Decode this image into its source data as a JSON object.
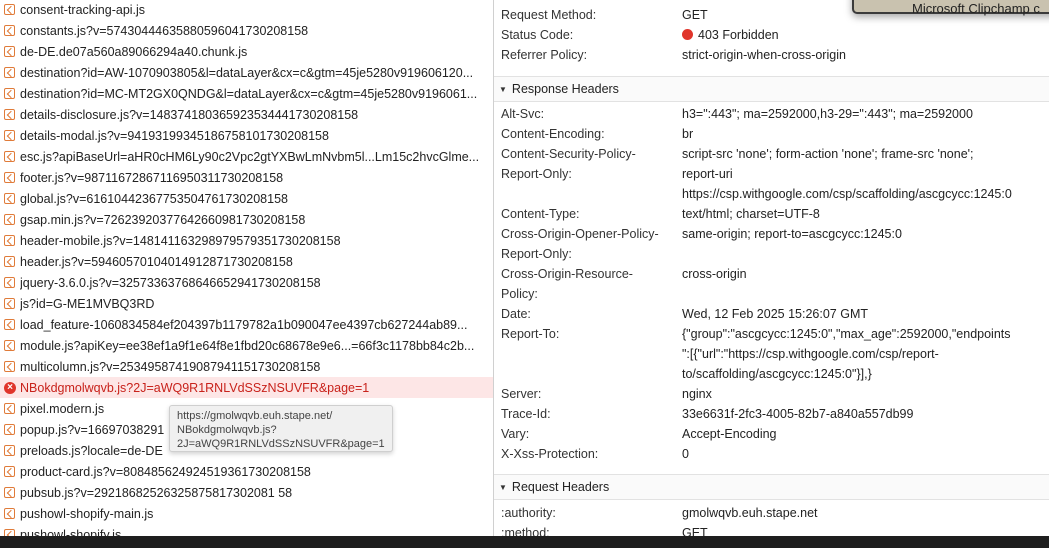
{
  "files": [
    {
      "name": "consent-tracking-api.js",
      "status": "ok"
    },
    {
      "name": "constants.js?v=57430444635880596041730208158",
      "status": "ok"
    },
    {
      "name": "de-DE.de07a560a89066294a40.chunk.js",
      "status": "ok"
    },
    {
      "name": "destination?id=AW-1070903805&l=dataLayer&cx=c&gtm=45je5280v919606120...",
      "status": "ok"
    },
    {
      "name": "destination?id=MC-MT2GX0QNDG&l=dataLayer&cx=c&gtm=45je5280v9196061...",
      "status": "ok"
    },
    {
      "name": "details-disclosure.js?v=148374180365923534441730208158",
      "status": "ok"
    },
    {
      "name": "details-modal.js?v=94193199345186758101730208158",
      "status": "ok"
    },
    {
      "name": "esc.js?apiBaseUrl=aHR0cHM6Ly90c2Vpc2gtYXBwLmNvbm5l...Lm15c2hvcGlme...",
      "status": "ok"
    },
    {
      "name": "footer.js?v=98711672867116950311730208158",
      "status": "ok"
    },
    {
      "name": "global.js?v=61610442367753504761730208158",
      "status": "ok"
    },
    {
      "name": "gsap.min.js?v=72623920377642660981730208158",
      "status": "ok"
    },
    {
      "name": "header-mobile.js?v=148141163298979579351730208158",
      "status": "ok"
    },
    {
      "name": "header.js?v=59460570104014912871730208158",
      "status": "ok"
    },
    {
      "name": "jquery-3.6.0.js?v=32573363768646652941730208158",
      "status": "ok"
    },
    {
      "name": "js?id=G-ME1MVBQ3RD",
      "status": "ok"
    },
    {
      "name": "load_feature-1060834584ef204397b1179782a1b090047ee4397cb627244ab89...",
      "status": "ok"
    },
    {
      "name": "module.js?apiKey=ee38ef1a9f1e64f8e1fbd20c68678e9e6...=66f3c1178bb84c2b...",
      "status": "ok"
    },
    {
      "name": "multicolumn.js?v=25349587419087941151730208158",
      "status": "ok"
    },
    {
      "name": "NBokdgmolwqvb.js?2J=aWQ9R1RNLVdSSzNSUVFR&page=1",
      "status": "error"
    },
    {
      "name": "pixel.modern.js",
      "status": "ok"
    },
    {
      "name": "popup.js?v=16697038291",
      "status": "ok"
    },
    {
      "name": "preloads.js?locale=de-DE",
      "status": "ok"
    },
    {
      "name": "product-card.js?v=80848562492451936173020815​8",
      "status": "ok"
    },
    {
      "name": "pubsub.js?v=29218682526325875817302081 58",
      "status": "ok"
    },
    {
      "name": "pushowl-shopify-main.js",
      "status": "ok"
    },
    {
      "name": "pushowl-shopify.js",
      "status": "ok"
    }
  ],
  "tooltip": {
    "lines": [
      "https://gmolwqvb.euh.stape.net/",
      "NBokdgmolwqvb.js?",
      "2J=aWQ9R1RNLVdSSzNSUVFR&page=1"
    ]
  },
  "general": [
    {
      "key": "Request Method:",
      "value": "GET"
    },
    {
      "key": "Status Code:",
      "value": "403 Forbidden"
    },
    {
      "key": "Referrer Policy:",
      "value": "strict-origin-when-cross-origin"
    }
  ],
  "response_section": "Response Headers",
  "response_headers": [
    {
      "key": "Alt-Svc:",
      "value": [
        "h3=\":443\"; ma=2592000,h3-29=\":443\"; ma=2592000"
      ]
    },
    {
      "key": "Content-Encoding:",
      "value": [
        "br"
      ]
    },
    {
      "key": [
        "Content-Security-Policy-",
        "Report-Only:"
      ],
      "value": [
        "script-src 'none'; form-action 'none'; frame-src 'none';",
        "report-uri",
        "https://csp.withgoogle.com/csp/scaffolding/ascgcycc:1245:0"
      ]
    },
    {
      "key": "Content-Type:",
      "value": [
        "text/html; charset=UTF-8"
      ]
    },
    {
      "key": [
        "Cross-Origin-Opener-Policy-",
        "Report-Only:"
      ],
      "value": [
        "same-origin; report-to=ascgcycc:1245:0"
      ]
    },
    {
      "key": [
        "Cross-Origin-Resource-",
        "Policy:"
      ],
      "value": [
        "cross-origin"
      ]
    },
    {
      "key": "Date:",
      "value": [
        "Wed, 12 Feb 2025 15:26:07 GMT"
      ]
    },
    {
      "key": "Report-To:",
      "value": [
        "{\"group\":\"ascgcycc:1245:0\",\"max_age\":2592000,\"endpoints",
        "\":[{\"url\":\"https://csp.withgoogle.com/csp/report-",
        "to/scaffolding/ascgcycc:1245:0\"}],}"
      ]
    },
    {
      "key": "Server:",
      "value": [
        "nginx"
      ]
    },
    {
      "key": "Trace-Id:",
      "value": [
        "33e6631f-2fc3-4005-82b7-a840a557db99"
      ]
    },
    {
      "key": "Vary:",
      "value": [
        "Accept-Encoding"
      ]
    },
    {
      "key": "X-Xss-Protection:",
      "value": [
        "0"
      ]
    }
  ],
  "request_section": "Request Headers",
  "request_headers": [
    {
      "key": ":authority:",
      "value": "gmolwqvb.euh.stape.net"
    },
    {
      "key": ":method:",
      "value": "GET"
    }
  ],
  "toast": {
    "label": "Microsoft Clipchamp c"
  },
  "colors": {
    "error": "#e0352b",
    "error_row_bg": "#fde6e6",
    "js_icon": "#e07b39"
  }
}
